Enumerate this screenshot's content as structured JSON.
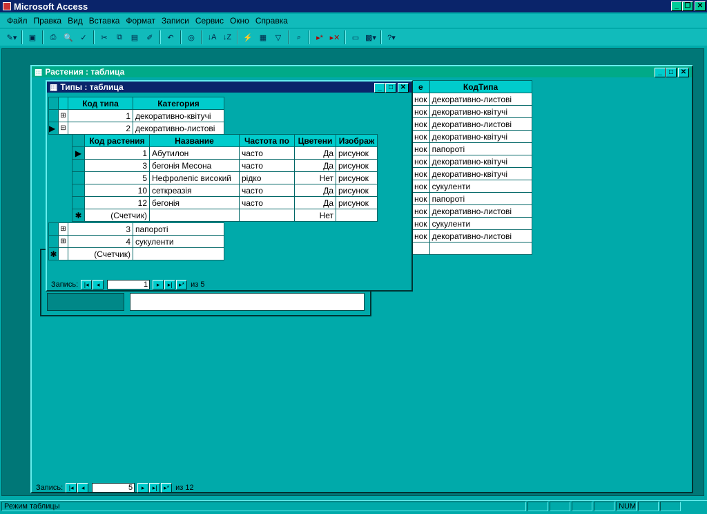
{
  "app": {
    "title": "Microsoft Access"
  },
  "menu": [
    "Файл",
    "Правка",
    "Вид",
    "Вставка",
    "Формат",
    "Записи",
    "Сервис",
    "Окно",
    "Справка"
  ],
  "plants_window": {
    "title": "Растения : таблица",
    "columns_visible": [
      "е",
      "КодТипа"
    ],
    "rows": [
      {
        "c1": "нок",
        "kod": "декоративно-листові"
      },
      {
        "c1": "нок",
        "kod": "декоративно-квітучі"
      },
      {
        "c1": "нок",
        "kod": "декоративно-листові"
      },
      {
        "c1": "нок",
        "kod": "декоративно-квітучі"
      },
      {
        "c1": "нок",
        "kod": "папороті"
      },
      {
        "c1": "нок",
        "kod": "декоративно-квітучі"
      },
      {
        "c1": "нок",
        "kod": "декоративно-квітучі"
      },
      {
        "c1": "нок",
        "kod": "сукуленти"
      },
      {
        "c1": "нок",
        "kod": "папороті"
      },
      {
        "c1": "нок",
        "kod": "декоративно-листові"
      },
      {
        "c1": "нок",
        "kod": "сукуленти"
      },
      {
        "c1": "нок",
        "kod": "декоративно-листові"
      }
    ],
    "nav": {
      "label": "Запись:",
      "current": "5",
      "of": "из 12"
    }
  },
  "types_window": {
    "title": "Типы : таблица",
    "headers": [
      "Код типа",
      "Категория"
    ],
    "rows_top": [
      {
        "id": "1",
        "cat": "декоративно-квітучі",
        "exp": "⊞"
      },
      {
        "id": "2",
        "cat": "декоративно-листові",
        "exp": "⊟"
      }
    ],
    "rows_bottom": [
      {
        "id": "3",
        "cat": "папороті",
        "exp": "⊞"
      },
      {
        "id": "4",
        "cat": "сукуленти",
        "exp": "⊞"
      }
    ],
    "new_row": "(Счетчик)",
    "nav": {
      "label": "Запись:",
      "current": "1",
      "of": "из 5"
    }
  },
  "subtable": {
    "headers": [
      "Код растения",
      "Название",
      "Частота по",
      "Цветени",
      "Изображ"
    ],
    "rows": [
      {
        "id": "1",
        "name": "Абутилон",
        "freq": "часто",
        "flower": "Да",
        "img": "рисунок"
      },
      {
        "id": "3",
        "name": "бегонія Месона",
        "freq": "часто",
        "flower": "Да",
        "img": "рисунок"
      },
      {
        "id": "5",
        "name": "Нефролепіс високий",
        "freq": "рідко",
        "flower": "Нет",
        "img": "рисунок"
      },
      {
        "id": "10",
        "name": "сеткреазія",
        "freq": "часто",
        "flower": "Да",
        "img": "рисунок"
      },
      {
        "id": "12",
        "name": "бегонія",
        "freq": "часто",
        "flower": "Да",
        "img": "рисунок"
      }
    ],
    "new_row": {
      "id": "(Счетчик)",
      "flower": "Нет"
    }
  },
  "status": {
    "text": "Режим таблицы",
    "num": "NUM"
  }
}
